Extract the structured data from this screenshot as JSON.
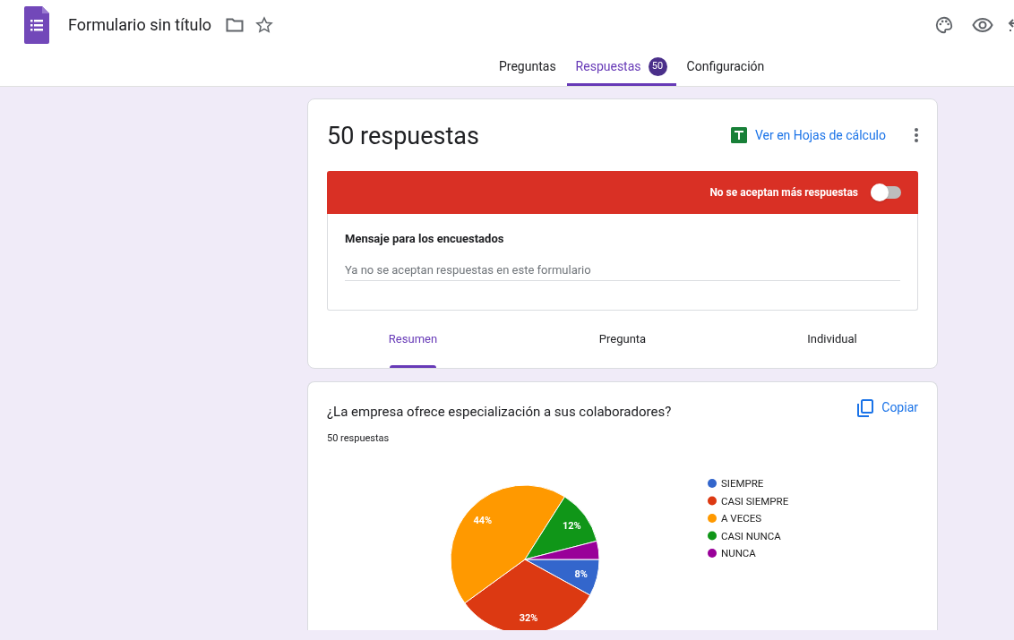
{
  "header": {
    "title": "Formulario sin título"
  },
  "tabs": [
    {
      "label": "Preguntas",
      "selected": false
    },
    {
      "label": "Respuestas",
      "selected": true,
      "badge": "50"
    },
    {
      "label": "Configuración",
      "selected": false
    }
  ],
  "summary": {
    "title": "50 respuestas",
    "sheets_link": "Ver en Hojas de cálculo",
    "banner": {
      "label": "No se aceptan más respuestas",
      "on": false
    },
    "message": {
      "label": "Mensaje para los encuestados",
      "value": "Ya no se aceptan respuestas en este formulario"
    },
    "view_tabs": [
      {
        "label": "Resumen",
        "selected": true
      },
      {
        "label": "Pregunta",
        "selected": false
      },
      {
        "label": "Individual",
        "selected": false
      }
    ]
  },
  "question": {
    "title": "¿La empresa ofrece especialización a sus colaboradores?",
    "count": "50 respuestas",
    "copy": "Copiar",
    "chart_data": {
      "type": "pie",
      "categories": [
        "SIEMPRE",
        "CASI SIEMPRE",
        "A VECES",
        "CASI NUNCA",
        "NUNCA"
      ],
      "values": [
        8,
        32,
        44,
        12,
        4
      ],
      "legend": "right",
      "colors": [
        "#3366cc",
        "#dc3912",
        "#ff9900",
        "#109618",
        "#990099"
      ],
      "value_labels": [
        "8%",
        "32%",
        "44%",
        "12%",
        null
      ]
    }
  }
}
